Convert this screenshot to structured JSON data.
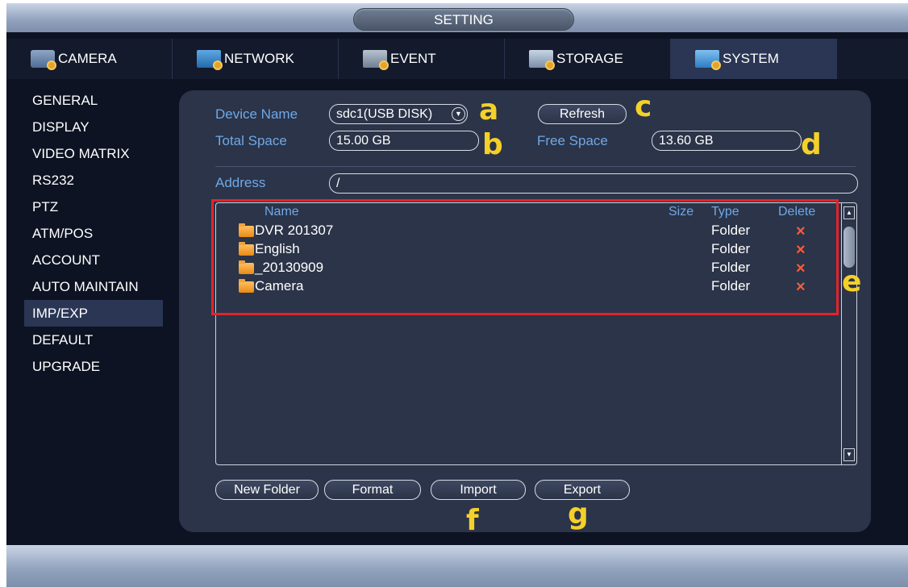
{
  "window": {
    "title": "SETTING"
  },
  "tabs": [
    {
      "label": "CAMERA",
      "icon": "camera-gear-icon"
    },
    {
      "label": "NETWORK",
      "icon": "network-gear-icon"
    },
    {
      "label": "EVENT",
      "icon": "event-gear-icon"
    },
    {
      "label": "STORAGE",
      "icon": "storage-gear-icon"
    },
    {
      "label": "SYSTEM",
      "icon": "system-gear-icon",
      "active": true
    }
  ],
  "sidebar": {
    "items": [
      {
        "label": "GENERAL"
      },
      {
        "label": "DISPLAY"
      },
      {
        "label": "VIDEO MATRIX"
      },
      {
        "label": "RS232"
      },
      {
        "label": "PTZ"
      },
      {
        "label": "ATM/POS"
      },
      {
        "label": "ACCOUNT"
      },
      {
        "label": "AUTO MAINTAIN"
      },
      {
        "label": "IMP/EXP",
        "active": true
      },
      {
        "label": "DEFAULT"
      },
      {
        "label": "UPGRADE"
      }
    ]
  },
  "form": {
    "device_name_label": "Device Name",
    "device_name_value": "sdc1(USB DISK)",
    "refresh_label": "Refresh",
    "total_space_label": "Total Space",
    "total_space_value": "15.00 GB",
    "free_space_label": "Free Space",
    "free_space_value": "13.60 GB",
    "address_label": "Address",
    "address_value": "/"
  },
  "filelist": {
    "headers": {
      "name": "Name",
      "size": "Size",
      "type": "Type",
      "delete": "Delete"
    },
    "rows": [
      {
        "name": "DVR 201307",
        "type": "Folder",
        "delete": "×"
      },
      {
        "name": "English",
        "type": "Folder",
        "delete": "×"
      },
      {
        "name": "_20130909",
        "type": "Folder",
        "delete": "×"
      },
      {
        "name": "Camera",
        "type": "Folder",
        "delete": "×"
      }
    ]
  },
  "buttons": {
    "new_folder": "New Folder",
    "format": "Format",
    "import": "Import",
    "export": "Export"
  },
  "annotations": {
    "a": "a",
    "b": "b",
    "c": "c",
    "d": "d",
    "e": "e",
    "f": "f",
    "g": "g"
  },
  "colors": {
    "label_blue": "#6fa8e8",
    "annotation_yellow": "#f4d02a",
    "highlight_red": "#e3242b",
    "delete_red": "#ff5a36"
  }
}
